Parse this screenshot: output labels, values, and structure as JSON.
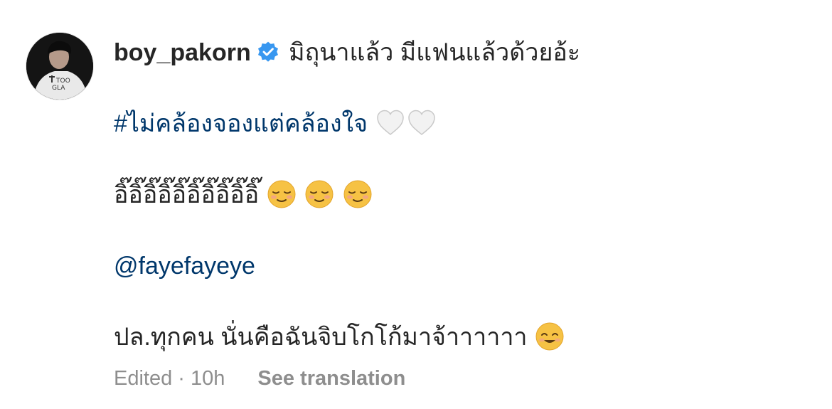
{
  "comment": {
    "username": "boy_pakorn",
    "verified_icon": "verified-badge-icon",
    "line1_text": "มิถุนาแล้ว มีแฟนแล้วด้วยอ้ะ",
    "hashtag": "#ไม่คล้องจองแต่คล้องใจ",
    "heart_emoji": "white-heart-icon",
    "line3_text": "อิ๊อิ๊อิ๊อิ๊อิ๊อิ๊อิ๊อิ๊อิ๊อิ๊",
    "smile_emoji": "smiling-face-icon",
    "mention": "@fayefayeye",
    "line5_text": "ปล.ทุกคน นั่นคือฉันจิบโกโก้มาจ้าาาาาา",
    "grin_emoji": "smiling-face-with-smiling-eyes-icon",
    "meta": {
      "status": "Edited · 10h",
      "see_translation": "See translation"
    }
  },
  "colors": {
    "text": "#262626",
    "link": "#00376b",
    "meta": "#8e8e8e",
    "verified": "#3897f0"
  }
}
